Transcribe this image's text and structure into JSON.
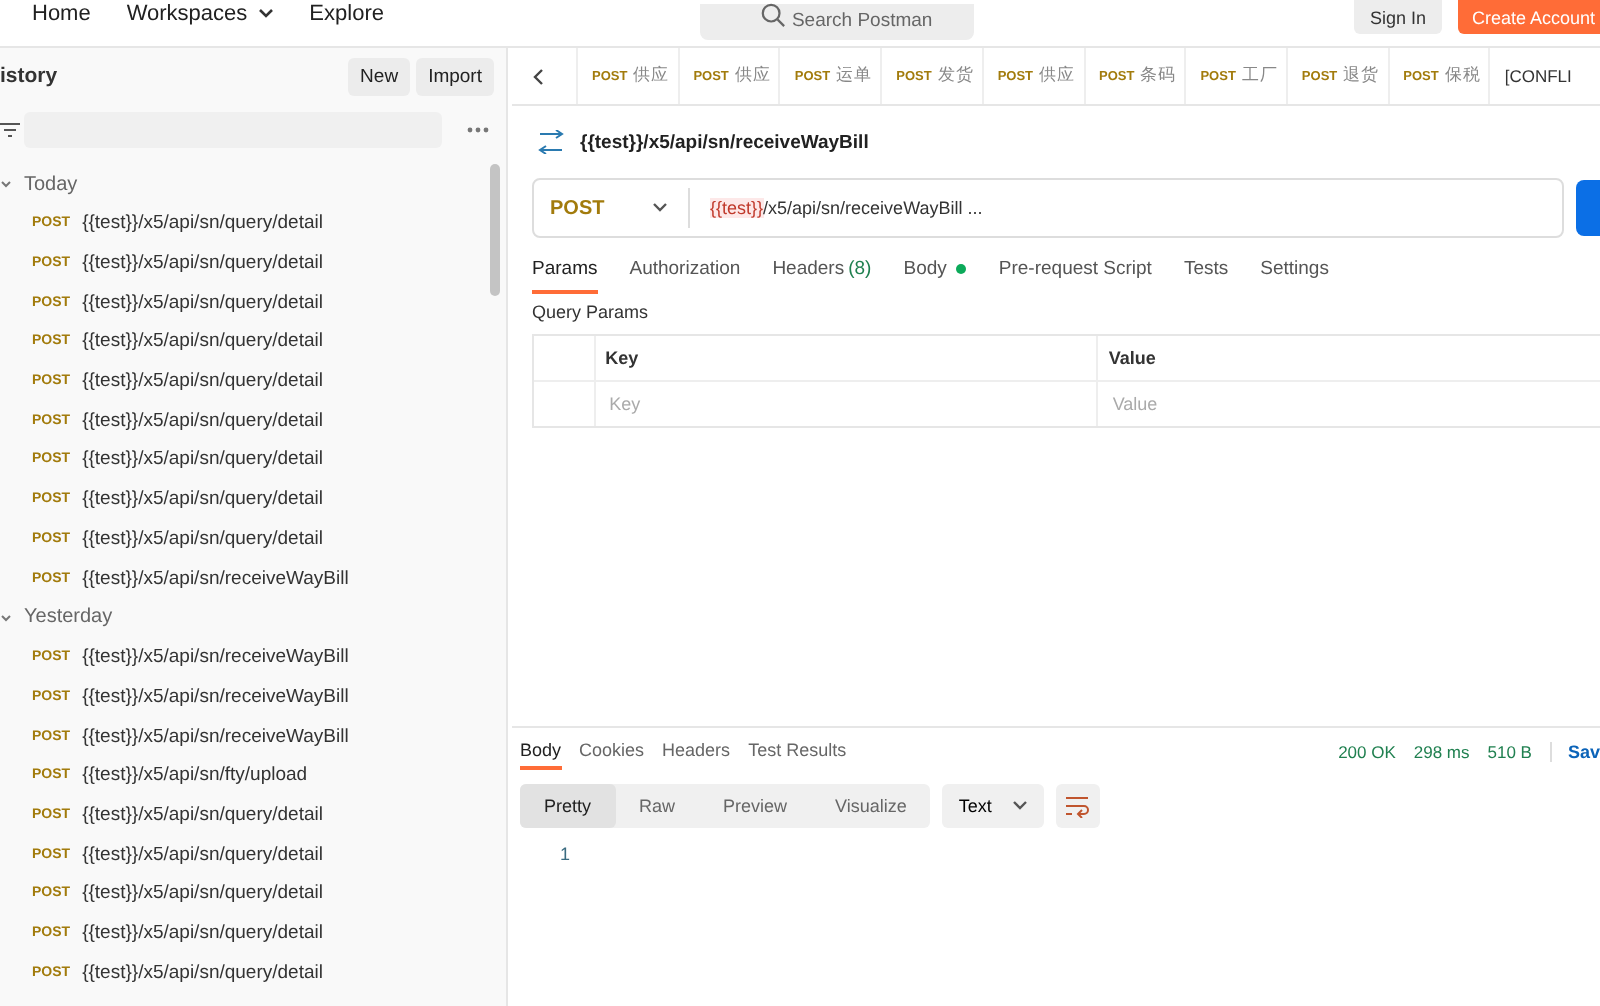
{
  "topbar": {
    "nav": [
      {
        "label": "Home",
        "dropdown": false
      },
      {
        "label": "Workspaces",
        "dropdown": true
      },
      {
        "label": "Explore",
        "dropdown": false
      }
    ],
    "search": {
      "placeholder": "Search Postman"
    },
    "sign_in": "Sign In",
    "create_account": "Create Account"
  },
  "sidebar": {
    "title": "istory",
    "buttons": [
      "New",
      "Import"
    ],
    "groups": [
      {
        "label": "Today",
        "expanded": true,
        "items": [
          {
            "method": "POST",
            "url": "{{test}}/x5/api/sn/query/detail"
          },
          {
            "method": "POST",
            "url": "{{test}}/x5/api/sn/query/detail"
          },
          {
            "method": "POST",
            "url": "{{test}}/x5/api/sn/query/detail"
          },
          {
            "method": "POST",
            "url": "{{test}}/x5/api/sn/query/detail"
          },
          {
            "method": "POST",
            "url": "{{test}}/x5/api/sn/query/detail"
          },
          {
            "method": "POST",
            "url": "{{test}}/x5/api/sn/query/detail"
          },
          {
            "method": "POST",
            "url": "{{test}}/x5/api/sn/query/detail"
          },
          {
            "method": "POST",
            "url": "{{test}}/x5/api/sn/query/detail"
          },
          {
            "method": "POST",
            "url": "{{test}}/x5/api/sn/query/detail"
          },
          {
            "method": "POST",
            "url": "{{test}}/x5/api/sn/receiveWayBill"
          }
        ]
      },
      {
        "label": "Yesterday",
        "expanded": true,
        "items": [
          {
            "method": "POST",
            "url": "{{test}}/x5/api/sn/receiveWayBill"
          },
          {
            "method": "POST",
            "url": "{{test}}/x5/api/sn/receiveWayBill"
          },
          {
            "method": "POST",
            "url": "{{test}}/x5/api/sn/receiveWayBill"
          },
          {
            "method": "POST",
            "url": "{{test}}/x5/api/sn/fty/upload"
          },
          {
            "method": "POST",
            "url": "{{test}}/x5/api/sn/query/detail"
          },
          {
            "method": "POST",
            "url": "{{test}}/x5/api/sn/query/detail"
          },
          {
            "method": "POST",
            "url": "{{test}}/x5/api/sn/query/detail"
          },
          {
            "method": "POST",
            "url": "{{test}}/x5/api/sn/query/detail"
          },
          {
            "method": "POST",
            "url": "{{test}}/x5/api/sn/query/detail"
          }
        ]
      }
    ]
  },
  "open_tabs": {
    "items": [
      {
        "method": "POST",
        "label": "供应"
      },
      {
        "method": "POST",
        "label": "供应"
      },
      {
        "method": "POST",
        "label": "运单"
      },
      {
        "method": "POST",
        "label": "发货"
      },
      {
        "method": "POST",
        "label": "供应"
      },
      {
        "method": "POST",
        "label": "条码"
      },
      {
        "method": "POST",
        "label": "工厂"
      },
      {
        "method": "POST",
        "label": "退货"
      },
      {
        "method": "POST",
        "label": "保税"
      }
    ],
    "overflow": "[CONFLI"
  },
  "request": {
    "title": "{{test}}/x5/api/sn/receiveWayBill",
    "method": "POST",
    "url_variable": "{{test}}",
    "url_rest": "/x5/api/sn/receiveWayBill ...",
    "tabs": [
      {
        "label": "Params",
        "selected": true
      },
      {
        "label": "Authorization",
        "selected": false
      },
      {
        "label": "Headers",
        "count": "(8)",
        "selected": false
      },
      {
        "label": "Body",
        "has_content": true,
        "selected": false
      },
      {
        "label": "Pre-request Script",
        "selected": false
      },
      {
        "label": "Tests",
        "selected": false
      },
      {
        "label": "Settings",
        "selected": false
      }
    ],
    "query_params": {
      "title": "Query Params",
      "columns": [
        "Key",
        "Value"
      ],
      "placeholders": [
        "Key",
        "Value"
      ]
    }
  },
  "response": {
    "tabs": [
      {
        "label": "Body",
        "selected": true
      },
      {
        "label": "Cookies",
        "selected": false
      },
      {
        "label": "Headers",
        "selected": false
      },
      {
        "label": "Test Results",
        "selected": false
      }
    ],
    "status": "200 OK",
    "time": "298 ms",
    "size": "510 B",
    "save": "Sav",
    "views": [
      {
        "label": "Pretty",
        "selected": true
      },
      {
        "label": "Raw",
        "selected": false
      },
      {
        "label": "Preview",
        "selected": false
      },
      {
        "label": "Visualize",
        "selected": false
      }
    ],
    "format": "Text",
    "lines": [
      "1"
    ]
  }
}
